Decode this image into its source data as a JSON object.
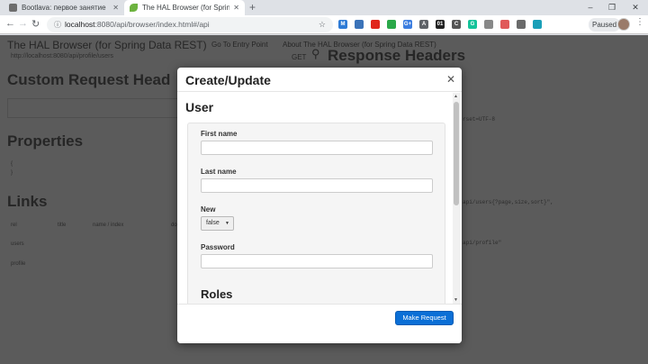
{
  "browser": {
    "tabs": [
      {
        "title": "Bootlava: первое занятие",
        "favicon_color": "#6d6d6d"
      },
      {
        "title": "The HAL Browser (for Spring Data",
        "favicon_color": "#6db33f"
      }
    ],
    "new_tab": "+",
    "window_controls": {
      "minimize": "–",
      "maximize": "❐",
      "close": "✕"
    },
    "url": {
      "host": "localhost",
      "rest": ":8080/api/browser/index.html#/api"
    },
    "extensions": [
      {
        "name": "m-ext",
        "label": "M",
        "color": "#2e7bd6"
      },
      {
        "name": "flag-ext",
        "label": "",
        "color": "#3b73b9"
      },
      {
        "name": "opera-ext",
        "label": "",
        "color": "#e0251b"
      },
      {
        "name": "check-ext",
        "label": "",
        "color": "#2aa849"
      },
      {
        "name": "gplus-ext",
        "label": "G+",
        "color": "#3b7de0"
      },
      {
        "name": "translate-ext",
        "label": "A",
        "color": "#5f6368"
      },
      {
        "name": "o1-ext",
        "label": "01",
        "color": "#222222"
      },
      {
        "name": "c-ext",
        "label": "C",
        "color": "#555555"
      },
      {
        "name": "grammarly-ext",
        "label": "G",
        "color": "#15c39a"
      },
      {
        "name": "leaf-ext",
        "label": "",
        "color": "#888888"
      },
      {
        "name": "cloud-ext",
        "label": "",
        "color": "#e05a5a"
      },
      {
        "name": "wave-ext",
        "label": "",
        "color": "#6a6a6a"
      },
      {
        "name": "pin-ext",
        "label": "",
        "color": "#1a9fb8"
      }
    ],
    "paused_label": "Paused",
    "menu_icon": "⋮"
  },
  "page": {
    "brand": "The HAL Browser (for Spring Data REST)",
    "nav": [
      "Go To Entry Point",
      "About The HAL Browser (for Spring Data REST)"
    ],
    "url_line": "http://localhost:8080/api/profile/users",
    "custom_headers_heading": "Custom Request Head",
    "properties_heading": "Properties",
    "properties_braces": [
      "{",
      "}"
    ],
    "links_heading": "Links",
    "links_columns": [
      "rel",
      "title",
      "name / index",
      "do"
    ],
    "links_rows": [
      "users",
      "profile"
    ],
    "right_get": "GET",
    "response_headers_heading": "Response Headers",
    "code_lines": [
      "rset=UTF-8",
      "api/users{?page,size,sort}\",",
      "api/profile\""
    ]
  },
  "modal": {
    "title": "Create/Update",
    "close_icon": "✕",
    "section_title": "User",
    "fields": [
      {
        "label": "First name",
        "value": ""
      },
      {
        "label": "Last name",
        "value": ""
      },
      {
        "label": "New",
        "value": "false"
      },
      {
        "label": "Password",
        "value": ""
      }
    ],
    "roles_heading": "Roles",
    "submit_label": "Make Request"
  }
}
